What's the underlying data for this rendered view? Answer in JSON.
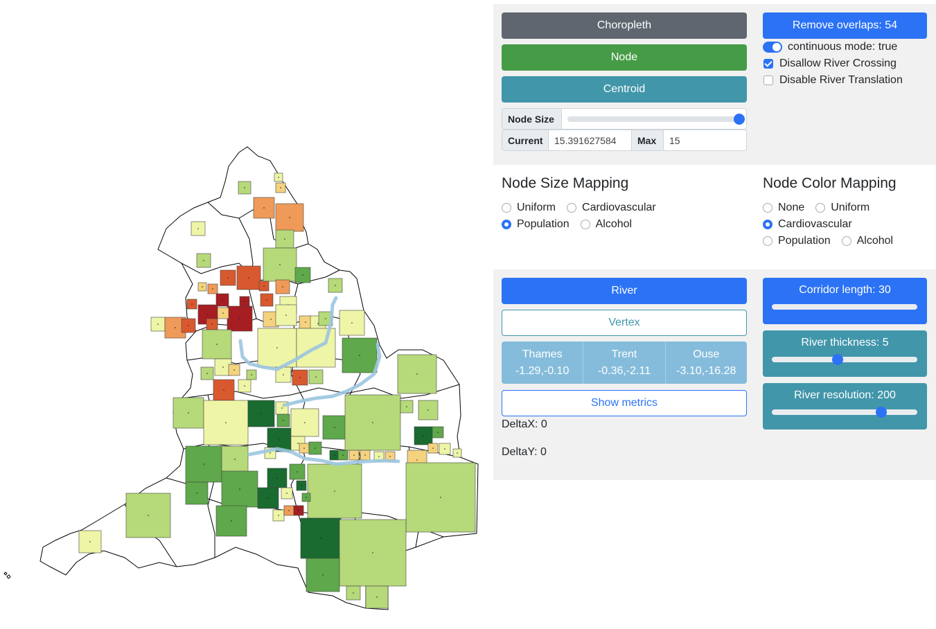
{
  "map": {
    "region_fill": "#ffffff",
    "outline_color": "#000000",
    "river_color": "#9cc6e0",
    "color_scale": [
      "#1a6b30",
      "#5fa84b",
      "#b6d97a",
      "#eef5a6",
      "#f5d27e",
      "#ef9a58",
      "#d9592f",
      "#a61e22"
    ]
  },
  "top_panel": {
    "choropleth_label": "Choropleth",
    "node_label": "Node",
    "centroid_label": "Centroid",
    "node_size_label": "Node Size",
    "node_size_level": 1.0,
    "current_label": "Current",
    "current_value": "15.391627584",
    "max_label": "Max",
    "max_value": "15",
    "remove_overlaps_label": "Remove overlaps: 54",
    "continuous_mode_label": "continuous mode: true",
    "disallow_river_crossing_label": "Disallow River Crossing",
    "disallow_river_crossing_checked": true,
    "disable_river_translation_label": "Disable River Translation",
    "disable_river_translation_checked": false
  },
  "node_size_mapping": {
    "title": "Node Size Mapping",
    "options": [
      "Uniform",
      "Cardiovascular",
      "Population",
      "Alcohol"
    ],
    "selected": "Population"
  },
  "node_color_mapping": {
    "title": "Node Color Mapping",
    "options": [
      "None",
      "Uniform",
      "Cardiovascular",
      "Population",
      "Alcohol"
    ],
    "selected": "Cardiovascular"
  },
  "river_panel": {
    "river_label": "River",
    "vertex_label": "Vertex",
    "rivers": [
      {
        "name": "Thames",
        "value": "-1.29,-0.10"
      },
      {
        "name": "Trent",
        "value": "-0.36,-2.11"
      },
      {
        "name": "Ouse",
        "value": "-3.10,-16.28"
      }
    ],
    "show_metrics_label": "Show metrics",
    "delta_x": "DeltaX: 0",
    "delta_y": "DeltaY: 0",
    "corridor_length_label": "Corridor length: 30",
    "corridor_length_level": 1.0,
    "river_thickness_label": "River thickness: 5",
    "river_thickness_level": 0.45,
    "river_resolution_label": "River resolution: 200",
    "river_resolution_level": 0.75
  }
}
